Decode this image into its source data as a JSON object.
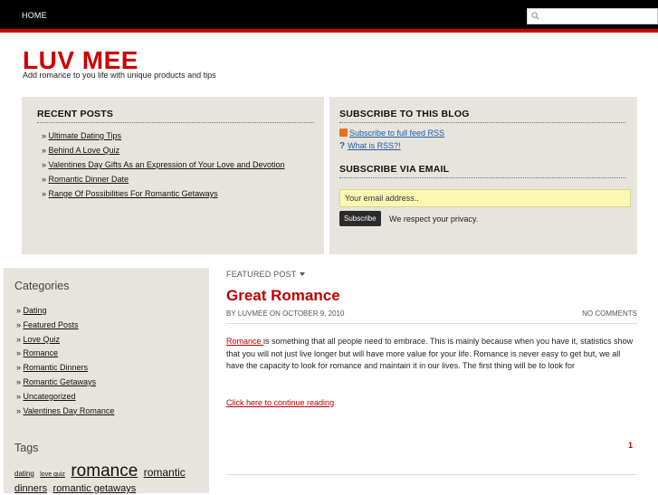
{
  "nav": {
    "home": "HOME"
  },
  "search": {
    "placeholder": ""
  },
  "site": {
    "title": "LUV MEE",
    "tagline": "Add romance to you life with unique products and tips"
  },
  "recent": {
    "title": "RECENT POSTS",
    "items": [
      "Ultimate Dating Tips",
      "Behind A Love Quiz",
      "Valentines Day Gifts As an Expression of Your Love and Devotion",
      "Romantic Dinner Date",
      "Range Of Possibilities For Romantic Getaways"
    ]
  },
  "subscribe": {
    "title": "SUBSCRIBE TO THIS BLOG",
    "rss_link": "Subscribe to full feed RSS",
    "what_rss": "What is RSS?!",
    "email_title": "SUBSCRIBE VIA EMAIL",
    "email_value": "Your email address..",
    "button": "Subscribe",
    "privacy": "We respect your privacy."
  },
  "categories": {
    "title": "Categories",
    "items": [
      "Dating",
      "Featured Posts",
      "Love Quiz",
      "Romance",
      "Romantic Dinners",
      "Romantic Getaways",
      "Uncategorized",
      "Valentines Day Romance"
    ]
  },
  "tags": {
    "title": "Tags",
    "items": [
      {
        "label": "dating",
        "size": 8
      },
      {
        "label": "love quiz",
        "size": 7
      },
      {
        "label": "romance",
        "size": 19
      },
      {
        "label": "romantic",
        "size": 12
      },
      {
        "label": "dinners",
        "size": 11
      },
      {
        "label": "romantic getaways",
        "size": 11
      }
    ]
  },
  "post": {
    "section": "FEATURED POST",
    "title": "Great Romance",
    "byline": "BY LUVMEE ON OCTOBER 9, 2010",
    "comments": "NO COMMENTS",
    "lead_link": "Romance ",
    "body": "is something that all people need to embrace. This is mainly because when you have it, statistics show that you will not just live longer but will have more value for your life. Romance is never easy to get but, we all have the capacity to look for romance and maintain it in our lives. The first thing will be to look for",
    "continue": "Click here to continue reading",
    "page": "1"
  },
  "colors": {
    "accent": "#cc0000",
    "panel": "#e6e4dc",
    "link_blue": "#1c5fa8"
  }
}
